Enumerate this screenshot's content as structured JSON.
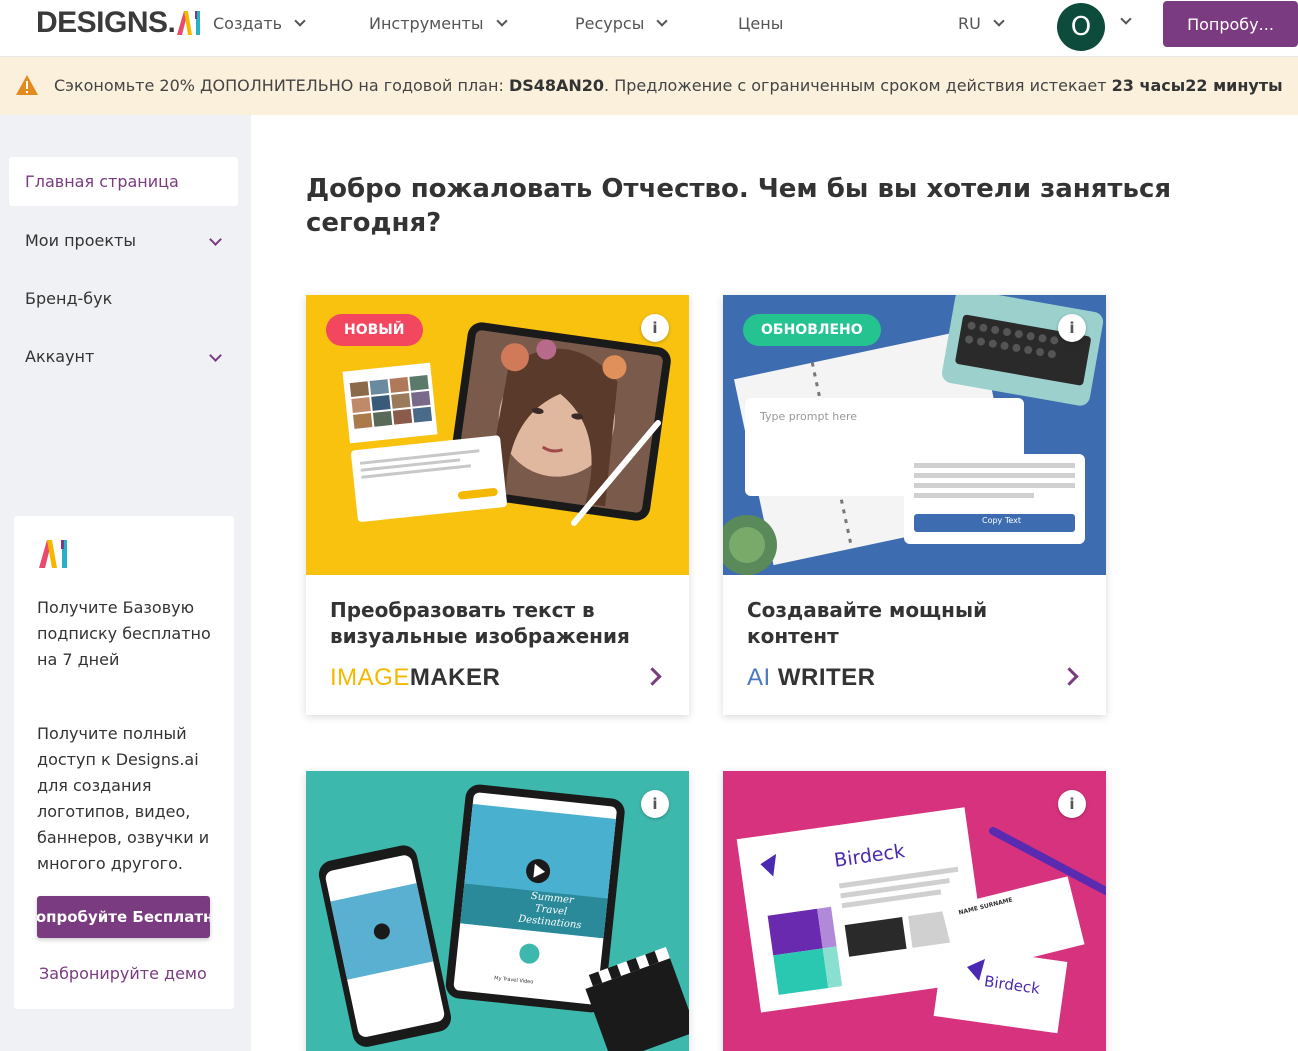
{
  "nav": {
    "logo_main": "DESIGNS.",
    "logo_ai": "AI",
    "items": [
      {
        "label": "Создать"
      },
      {
        "label": "Инструменты"
      },
      {
        "label": "Ресурсы"
      },
      {
        "label": "Цены"
      }
    ],
    "language": "RU",
    "avatar_initial": "O",
    "try_button": "Попробу..."
  },
  "promo": {
    "text_before": "Сэкономьте 20% ДОПОЛНИТЕЛЬНО на годовой план: ",
    "code": "DS48AN20",
    "text_middle": ". Предложение с ограниченным сроком действия истекает ",
    "timer": "23 часы22 минуты"
  },
  "sidebar": {
    "items": [
      {
        "label": "Главная страница"
      },
      {
        "label": "Мои проекты"
      },
      {
        "label": "Бренд-бук"
      },
      {
        "label": "Аккаунт"
      }
    ],
    "promo_card": {
      "text1": "Получите Базовую подписку бесплатно на 7 дней",
      "text2": "Получите полный доступ к Designs.ai для создания логотипов, видео, баннеров, озвучки и многого другого.",
      "button": "Попробуйте Бесплатно",
      "link": "Забронируйте демо"
    }
  },
  "main": {
    "welcome": "Добро пожаловать Отчество. Чем бы вы хотели заняться сегодня?",
    "cards": [
      {
        "badge": "НОВЫЙ",
        "title": "Преобразовать текст в визуальные изображения",
        "brand_light": "IMAGE",
        "brand_heavy": "MAKER",
        "colors": {
          "bg": "#f9c20e",
          "badge": "#f2475f",
          "brand": "#f5b800"
        }
      },
      {
        "badge": "ОБНОВЛЕНО",
        "title": "Создавайте мощный контент",
        "brand_light": "AI",
        "brand_heavy": " WRITER",
        "prompt_placeholder": "Type prompt here",
        "copy_button": "Copy Text",
        "colors": {
          "bg": "#3d6db0",
          "badge": "#24c38f",
          "brand": "#4a78c2"
        }
      },
      {
        "colors": {
          "bg": "#3db8ad"
        },
        "video_caption": "Summer Travel Destinations",
        "video_title": "My Travel Video"
      },
      {
        "colors": {
          "bg": "#d6327e"
        },
        "brand_sample": "Birdeck",
        "card_name": "NAME SURNAME"
      }
    ]
  },
  "colors": {
    "accent": "#7a3b80",
    "promo_bg": "#faf0dc",
    "sidebar_bg": "#f0f1f4",
    "avatar_bg": "#0d4b3c"
  }
}
